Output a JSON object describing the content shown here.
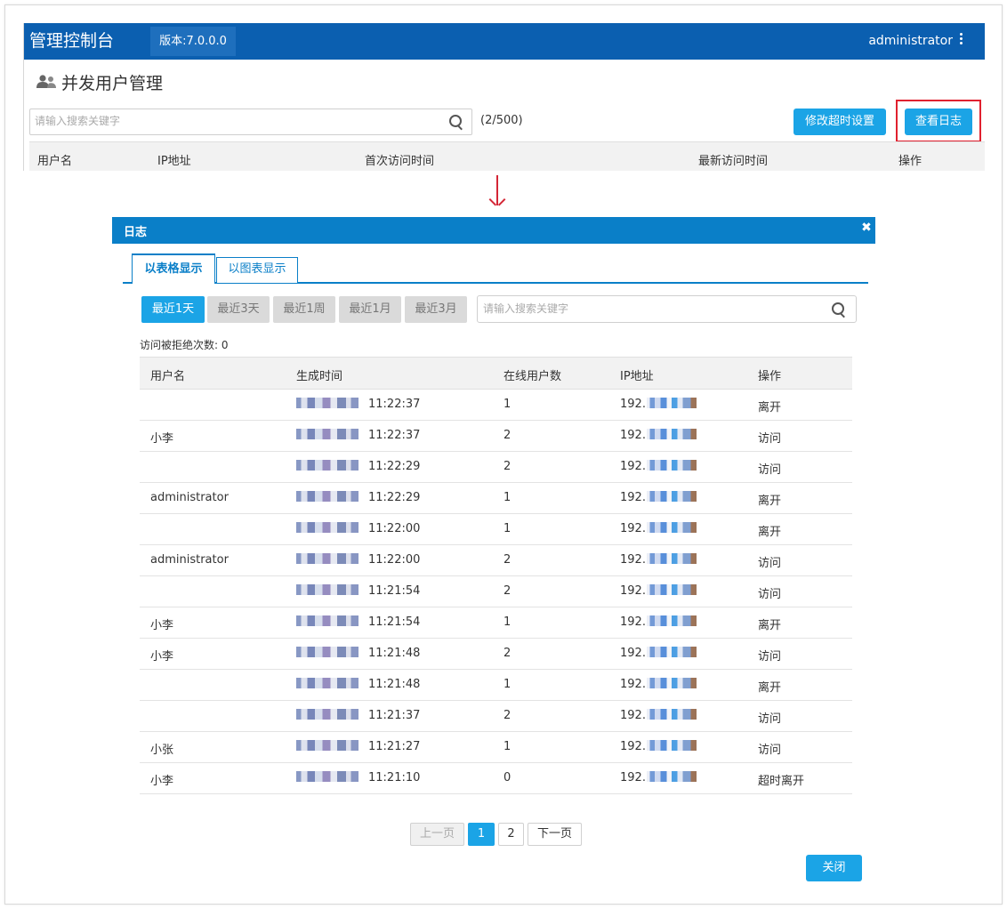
{
  "console": {
    "app_title": "管理控制台",
    "version": "版本:7.0.0.0",
    "user": "administrator",
    "page_title": "并发用户管理",
    "search_placeholder": "请输入搜索关键字",
    "count": "(2/500)",
    "btn_timeout": "修改超时设置",
    "btn_view_log": "查看日志",
    "columns": [
      "用户名",
      "IP地址",
      "首次访问时间",
      "最新访问时间",
      "操作"
    ]
  },
  "dialog": {
    "title": "日志",
    "close_glyph": "✖",
    "tabs": [
      "以表格显示",
      "以图表显示"
    ],
    "periods": [
      "最近1天",
      "最近3天",
      "最近1周",
      "最近1月",
      "最近3月"
    ],
    "active_period": 0,
    "search_placeholder": "请输入搜索关键字",
    "denied_label": "访问被拒绝次数: 0",
    "columns": [
      "用户名",
      "生成时间",
      "在线用户数",
      "IP地址",
      "操作"
    ],
    "rows": [
      {
        "user": "",
        "time": "11:22:37",
        "online": "1",
        "ip": "192.",
        "op": "离开"
      },
      {
        "user": "小李",
        "time": "11:22:37",
        "online": "2",
        "ip": "192.",
        "op": "访问"
      },
      {
        "user": "",
        "time": "11:22:29",
        "online": "2",
        "ip": "192.",
        "op": "访问"
      },
      {
        "user": "administrator",
        "time": "11:22:29",
        "online": "1",
        "ip": "192.",
        "op": "离开"
      },
      {
        "user": "",
        "time": "11:22:00",
        "online": "1",
        "ip": "192.",
        "op": "离开"
      },
      {
        "user": "administrator",
        "time": "11:22:00",
        "online": "2",
        "ip": "192.",
        "op": "访问"
      },
      {
        "user": "",
        "time": "11:21:54",
        "online": "2",
        "ip": "192.",
        "op": "访问"
      },
      {
        "user": "小李",
        "time": "11:21:54",
        "online": "1",
        "ip": "192.",
        "op": "离开"
      },
      {
        "user": "小李",
        "time": "11:21:48",
        "online": "2",
        "ip": "192.",
        "op": "访问"
      },
      {
        "user": "",
        "time": "11:21:48",
        "online": "1",
        "ip": "192.",
        "op": "离开"
      },
      {
        "user": "",
        "time": "11:21:37",
        "online": "2",
        "ip": "192.",
        "op": "访问"
      },
      {
        "user": "小张",
        "time": "11:21:27",
        "online": "1",
        "ip": "192.",
        "op": "访问"
      },
      {
        "user": "小李",
        "time": "11:21:10",
        "online": "0",
        "ip": "192.",
        "op": "超时离开"
      }
    ],
    "pager": {
      "prev": "上一页",
      "pages": [
        "1",
        "2"
      ],
      "current": "1",
      "next": "下一页"
    },
    "close_button": "关闭"
  }
}
